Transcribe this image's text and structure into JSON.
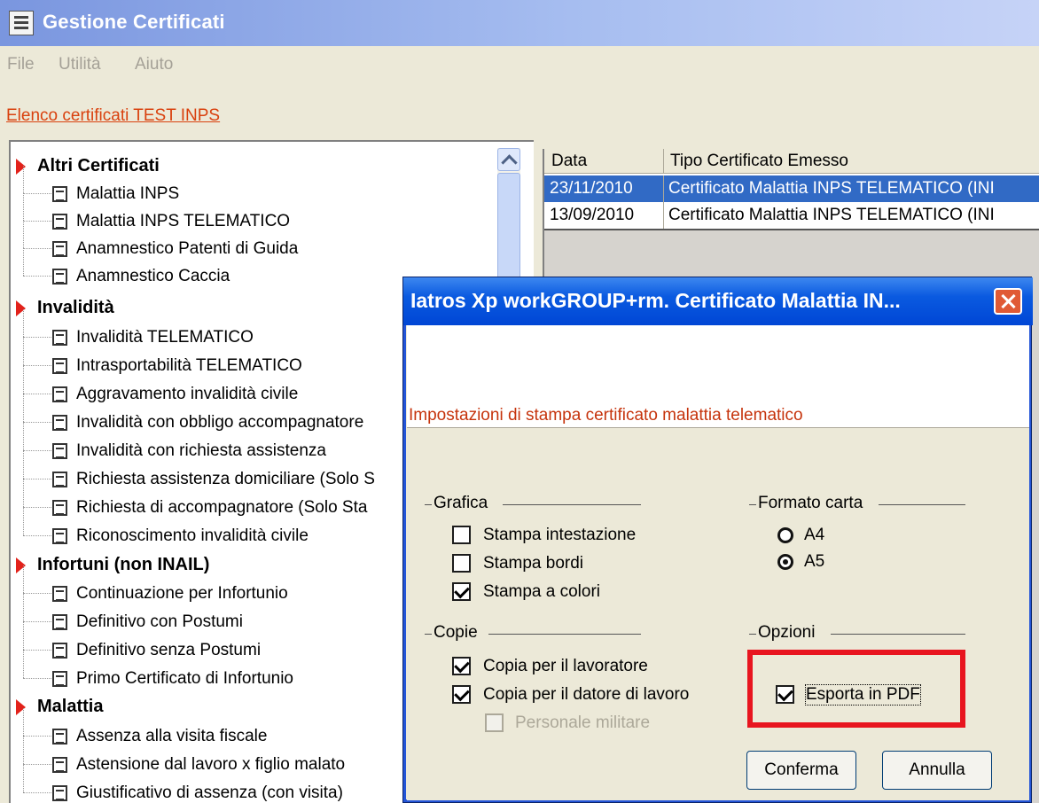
{
  "window": {
    "title": "Gestione Certificati",
    "icon": "document-list-icon"
  },
  "menu": [
    "File",
    "Utilità",
    "Aiuto"
  ],
  "header_link": "Elenco certificati TEST INPS",
  "tree": [
    {
      "type": "category",
      "label": "Altri Certificati"
    },
    {
      "type": "item",
      "label": "Malattia INPS"
    },
    {
      "type": "item",
      "label": "Malattia INPS TELEMATICO"
    },
    {
      "type": "item",
      "label": "Anamnestico Patenti di Guida"
    },
    {
      "type": "item",
      "label": "Anamnestico Caccia"
    },
    {
      "type": "category",
      "label": "Invalidità"
    },
    {
      "type": "item",
      "label": "Invalidità TELEMATICO"
    },
    {
      "type": "item",
      "label": "Intrasportabilità TELEMATICO"
    },
    {
      "type": "item",
      "label": "Aggravamento invalidità civile"
    },
    {
      "type": "item",
      "label": "Invalidità con obbligo accompagnatore"
    },
    {
      "type": "item",
      "label": "Invalidità con richiesta assistenza"
    },
    {
      "type": "item",
      "label": "Richiesta assistenza domiciliare (Solo S"
    },
    {
      "type": "item",
      "label": "Richiesta di accompagnatore (Solo Sta"
    },
    {
      "type": "item",
      "label": "Riconoscimento invalidità civile"
    },
    {
      "type": "category",
      "label": "Infortuni (non INAIL)"
    },
    {
      "type": "item",
      "label": "Continuazione per Infortunio"
    },
    {
      "type": "item",
      "label": "Definitivo con Postumi"
    },
    {
      "type": "item",
      "label": "Definitivo senza Postumi"
    },
    {
      "type": "item",
      "label": "Primo Certificato di Infortunio"
    },
    {
      "type": "category",
      "label": "Malattia"
    },
    {
      "type": "item",
      "label": "Assenza alla visita fiscale"
    },
    {
      "type": "item",
      "label": "Astensione dal lavoro x figlio malato"
    },
    {
      "type": "item",
      "label": "Giustificativo di assenza (con visita)"
    }
  ],
  "list": {
    "columns": [
      "Data",
      "Tipo Certificato Emesso"
    ],
    "rows": [
      {
        "date": "23/11/2010",
        "type": "Certificato Malattia INPS TELEMATICO (INI",
        "selected": true
      },
      {
        "date": "13/09/2010",
        "type": "Certificato Malattia INPS TELEMATICO (INI",
        "selected": false
      }
    ]
  },
  "dialog": {
    "title": "Iatros Xp workGROUP+rm. Certificato Malattia IN...",
    "subtitle": "Impostazioni di stampa certificato malattia telematico",
    "grafica": {
      "label": "Grafica",
      "options": [
        {
          "label": "Stampa intestazione",
          "checked": false
        },
        {
          "label": "Stampa bordi",
          "checked": false
        },
        {
          "label": "Stampa a colori",
          "checked": true
        }
      ]
    },
    "formato": {
      "label": "Formato carta",
      "options": [
        {
          "label": "A4",
          "selected": false
        },
        {
          "label": "A5",
          "selected": true
        }
      ]
    },
    "copie": {
      "label": "Copie",
      "options": [
        {
          "label": "Copia per il lavoratore",
          "checked": true
        },
        {
          "label": "Copia per il datore di lavoro",
          "checked": true
        },
        {
          "label": "Personale militare",
          "checked": false,
          "disabled": true
        }
      ]
    },
    "opzioni": {
      "label": "Opzioni",
      "options": [
        {
          "label": "Esporta in PDF",
          "checked": true
        }
      ]
    },
    "buttons": {
      "confirm": "Conferma",
      "cancel": "Annulla"
    }
  },
  "colors": {
    "highlight_box": "#e8151f",
    "selection": "#316ac5",
    "category_arrow": "#e2221b",
    "link": "#d9410e"
  }
}
